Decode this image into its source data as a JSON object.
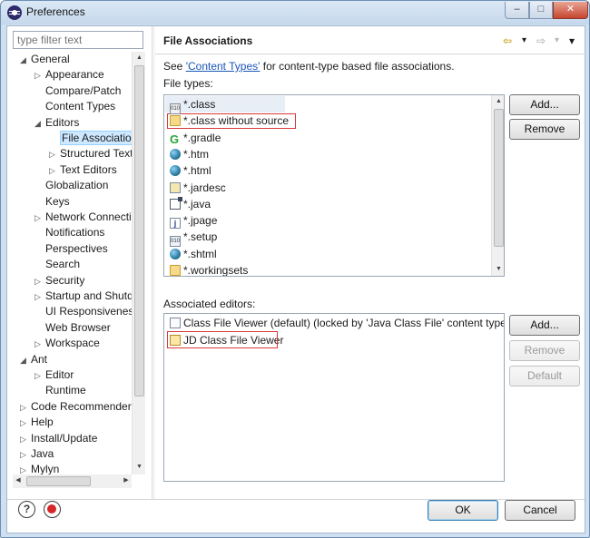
{
  "window": {
    "title": "Preferences",
    "min_label": "–",
    "max_label": "□",
    "close_label": "✕"
  },
  "sidebar": {
    "filter_placeholder": "type filter text",
    "items": [
      {
        "label": "General",
        "arrow": "◢"
      },
      {
        "label": "Appearance",
        "arrow": "▷"
      },
      {
        "label": "Compare/Patch",
        "arrow": ""
      },
      {
        "label": "Content Types",
        "arrow": ""
      },
      {
        "label": "Editors",
        "arrow": "◢"
      },
      {
        "label": "File Associatio",
        "arrow": ""
      },
      {
        "label": "Structured Text",
        "arrow": "▷"
      },
      {
        "label": "Text Editors",
        "arrow": "▷"
      },
      {
        "label": "Globalization",
        "arrow": ""
      },
      {
        "label": "Keys",
        "arrow": ""
      },
      {
        "label": "Network Connectio",
        "arrow": "▷"
      },
      {
        "label": "Notifications",
        "arrow": ""
      },
      {
        "label": "Perspectives",
        "arrow": ""
      },
      {
        "label": "Search",
        "arrow": ""
      },
      {
        "label": "Security",
        "arrow": "▷"
      },
      {
        "label": "Startup and Shutd",
        "arrow": "▷"
      },
      {
        "label": "UI Responsiveness",
        "arrow": ""
      },
      {
        "label": "Web Browser",
        "arrow": ""
      },
      {
        "label": "Workspace",
        "arrow": "▷"
      },
      {
        "label": "Ant",
        "arrow": "◢"
      },
      {
        "label": "Editor",
        "arrow": "▷"
      },
      {
        "label": "Runtime",
        "arrow": ""
      },
      {
        "label": "Code Recommenders",
        "arrow": "▷"
      },
      {
        "label": "Help",
        "arrow": "▷"
      },
      {
        "label": "Install/Update",
        "arrow": "▷"
      },
      {
        "label": "Java",
        "arrow": "▷"
      },
      {
        "label": "Mylyn",
        "arrow": "▷"
      }
    ]
  },
  "main": {
    "title": "File Associations",
    "nav": {
      "back": "⇦",
      "back_menu": "▾",
      "forward": "⇨",
      "forward_menu": "▾",
      "view_menu": "▾"
    },
    "info_prefix": "See ",
    "info_link": "'Content Types'",
    "info_suffix": " for content-type based file associations.",
    "file_types_label": "File types:",
    "file_types": [
      {
        "label": "*.class",
        "icon": "class-file-icon"
      },
      {
        "label": "*.class without source",
        "icon": "folder-icon"
      },
      {
        "label": "*.gradle",
        "icon": "gradle-icon"
      },
      {
        "label": "*.htm",
        "icon": "globe-icon"
      },
      {
        "label": "*.html",
        "icon": "globe-icon"
      },
      {
        "label": "*.jardesc",
        "icon": "jar-icon"
      },
      {
        "label": "*.java",
        "icon": "java-file-icon"
      },
      {
        "label": "*.jpage",
        "icon": "jpage-icon"
      },
      {
        "label": "*.setup",
        "icon": "setup-file-icon"
      },
      {
        "label": "*.shtml",
        "icon": "globe-icon"
      },
      {
        "label": "*.workingsets",
        "icon": "folder-icon"
      }
    ],
    "ft_add": "Add...",
    "ft_remove": "Remove",
    "editors_label": "Associated editors:",
    "editors": [
      {
        "label": "Class File Viewer (default) (locked by 'Java Class File' content type)",
        "icon": "editor-icon"
      },
      {
        "label": "JD Class File Viewer",
        "icon": "jd-icon"
      }
    ],
    "ed_add": "Add...",
    "ed_remove": "Remove",
    "ed_default": "Default"
  },
  "footer": {
    "ok": "OK",
    "cancel": "Cancel"
  },
  "colors": {
    "highlight": "#d63a3a",
    "link": "#1a56b8",
    "selection": "#cde8ff"
  }
}
